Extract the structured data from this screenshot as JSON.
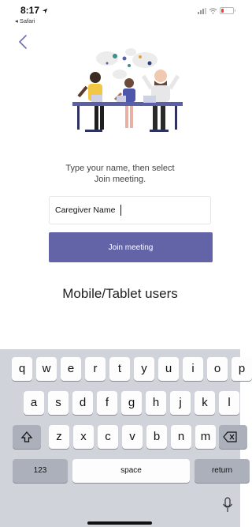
{
  "status": {
    "time": "8:17",
    "back_app": "◂ Safari"
  },
  "prompt": {
    "line1": "Type your name, then select",
    "line2": "Join meeting."
  },
  "name_field": {
    "value": "Caregiver Name"
  },
  "join_button": {
    "label": "Join meeting"
  },
  "caption": "Mobile/Tablet users",
  "keyboard": {
    "row1": [
      "q",
      "w",
      "e",
      "r",
      "t",
      "y",
      "u",
      "i",
      "o",
      "p"
    ],
    "row2": [
      "a",
      "s",
      "d",
      "f",
      "g",
      "h",
      "j",
      "k",
      "l"
    ],
    "row3": [
      "z",
      "x",
      "c",
      "v",
      "b",
      "n",
      "m"
    ],
    "numbers_label": "123",
    "space_label": "space",
    "return_label": "return"
  },
  "colors": {
    "accent": "#6264a7",
    "keyboard_bg": "#d0d3d9",
    "battery": "#ff3b30"
  }
}
